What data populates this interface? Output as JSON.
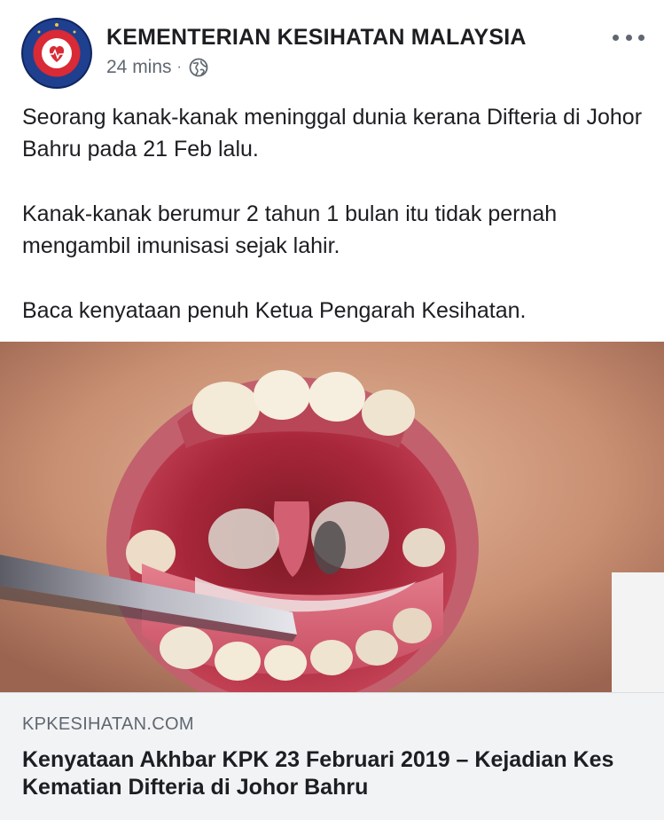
{
  "post": {
    "page_name": "KEMENTERIAN KESIHATAN MALAYSIA",
    "timestamp": "24 mins",
    "separator": "·",
    "privacy_icon": "globe-icon",
    "more_icon": "more-options-icon",
    "paragraphs": [
      "Seorang kanak-kanak meninggal dunia kerana Difteria di Johor Bahru pada 21 Feb lalu.",
      "Kanak-kanak berumur 2 tahun 1 bulan itu tidak pernah mengambil imunisasi sejak lahir.",
      "Baca kenyataan penuh Ketua Pengarah Kesihatan."
    ]
  },
  "link": {
    "domain": "KPKESIHATAN.COM",
    "title": "Kenyataan Akhbar KPK 23 Februari 2019 – Kejadian Kes Kematian Difteria di Johor Bahru",
    "image_subject": "open mouth with tongue depressor showing throat infection"
  },
  "colors": {
    "text_primary": "#1c1e21",
    "text_secondary": "#606770",
    "footer_bg": "#f2f3f5",
    "logo_red": "#d92a36",
    "logo_blue": "#1f3f8f"
  }
}
